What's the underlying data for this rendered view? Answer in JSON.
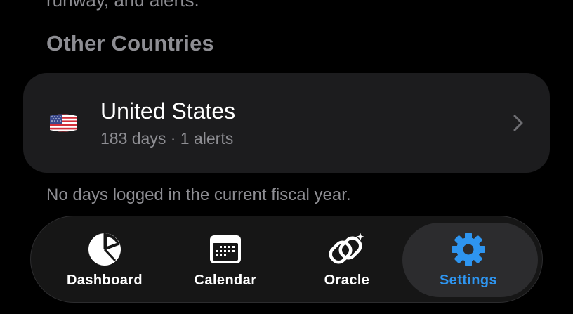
{
  "header_partial_text": "runway, and alerts.",
  "section": {
    "title": "Other Countries"
  },
  "country_card": {
    "flag_icon": "us-flag-icon",
    "name": "United States",
    "subtitle": "183 days · 1 alerts",
    "chevron_icon": "chevron-right-icon"
  },
  "footnote": "No days logged in the current fiscal year.",
  "tab_bar": {
    "active_tab": "Settings",
    "tabs": [
      {
        "label": "Dashboard",
        "icon": "pie-chart-icon"
      },
      {
        "label": "Calendar",
        "icon": "calendar-icon"
      },
      {
        "label": "Oracle",
        "icon": "oracle-sparkle-icon"
      },
      {
        "label": "Settings",
        "icon": "gear-icon"
      }
    ]
  },
  "colors": {
    "background": "#000000",
    "card": "#1c1c1e",
    "secondary_text": "#8e8e93",
    "accent": "#2e95f0",
    "tab_bar": "#161616",
    "tab_highlight": "#2c2c2e"
  }
}
